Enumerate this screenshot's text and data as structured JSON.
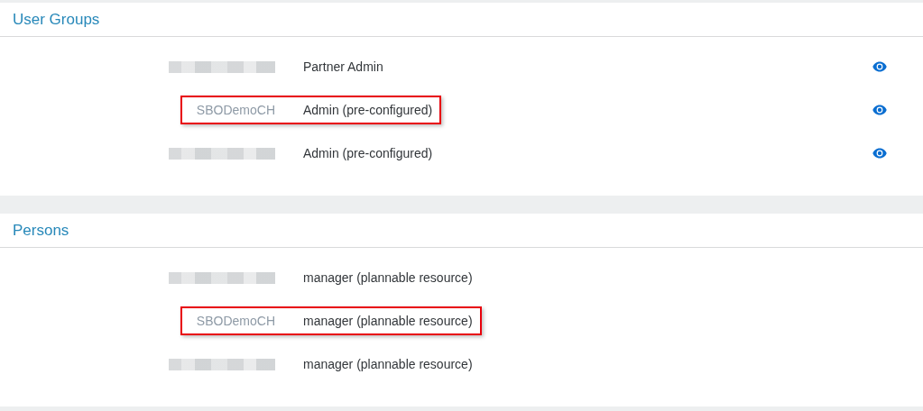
{
  "sections": [
    {
      "title": "User Groups",
      "rows": [
        {
          "id": null,
          "redacted": true,
          "role": "Partner Admin",
          "highlighted": false,
          "viewable": true
        },
        {
          "id": "SBODemoCH",
          "redacted": false,
          "role": "Admin (pre-configured)",
          "highlighted": true,
          "viewable": true
        },
        {
          "id": null,
          "redacted": true,
          "role": "Admin (pre-configured)",
          "highlighted": false,
          "viewable": true
        }
      ]
    },
    {
      "title": "Persons",
      "rows": [
        {
          "id": null,
          "redacted": true,
          "role": "manager (plannable resource)",
          "highlighted": false,
          "viewable": false
        },
        {
          "id": "SBODemoCH",
          "redacted": false,
          "role": "manager (plannable resource)",
          "highlighted": true,
          "viewable": false
        },
        {
          "id": null,
          "redacted": true,
          "role": "manager (plannable resource)",
          "highlighted": false,
          "viewable": false
        }
      ]
    }
  ]
}
